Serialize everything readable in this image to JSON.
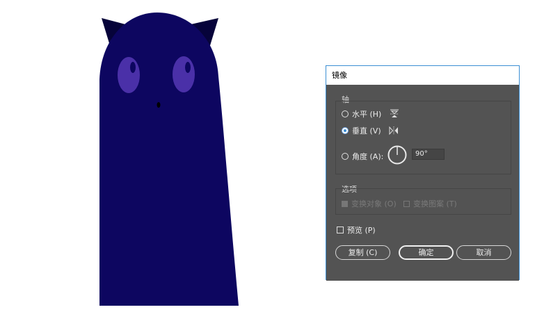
{
  "dialog": {
    "title": "镜像",
    "axis_group": {
      "label": "轴",
      "horizontal": {
        "label": "水平 (H)",
        "selected": false,
        "icon": "flip-horizontal-axis-icon"
      },
      "vertical": {
        "label": "垂直 (V)",
        "selected": true,
        "icon": "flip-vertical-axis-icon"
      },
      "angle": {
        "label": "角度 (A):",
        "selected": false,
        "value": "90°",
        "icon": "angle-dial-icon"
      }
    },
    "options_group": {
      "label": "选项",
      "transform_objects": {
        "label": "变换对象 (O)",
        "checked": true,
        "enabled": false
      },
      "transform_patterns": {
        "label": "变换图案 (T)",
        "checked": false,
        "enabled": false
      }
    },
    "preview": {
      "label": "预览 (P)",
      "checked": false
    },
    "buttons": {
      "copy": "复制 (C)",
      "ok": "确定",
      "cancel": "取消"
    }
  },
  "colors": {
    "figure_body": "#0d0660",
    "figure_ears": "#06033a",
    "figure_eyes": "#4a30a8",
    "figure_pupils": "#0d0660",
    "dialog_bg": "#535353",
    "accent": "#3c8fd4"
  }
}
